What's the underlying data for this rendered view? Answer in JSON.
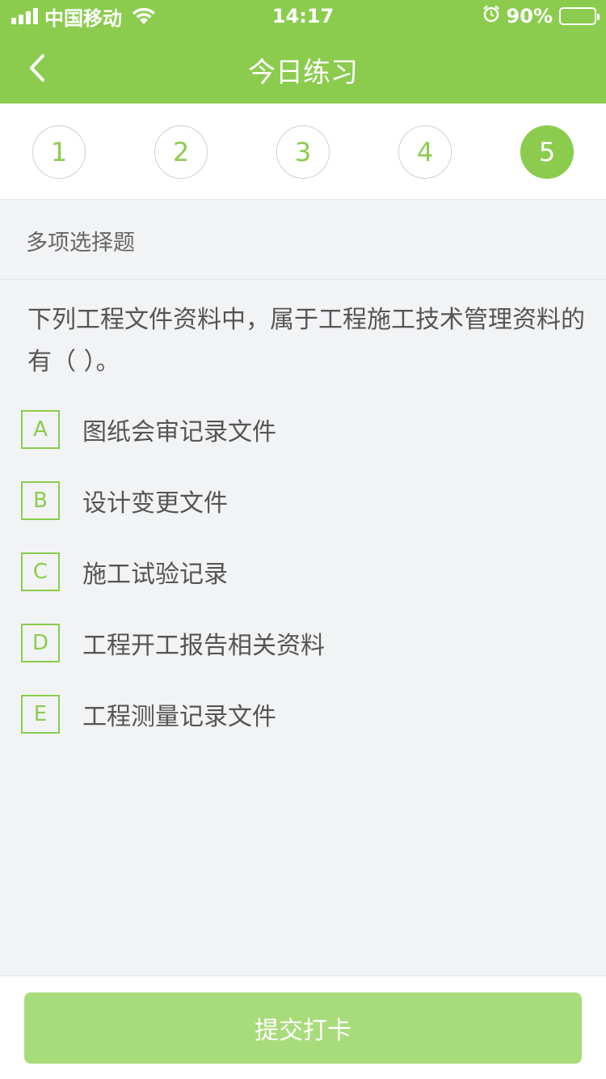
{
  "status_bar": {
    "carrier": "中国移动",
    "time": "14:17",
    "battery": "90%",
    "battery_level": 0.9
  },
  "nav": {
    "title": "今日练习",
    "back_icon": "chevron-left-icon"
  },
  "question_numbers": [
    {
      "label": "1",
      "active": false
    },
    {
      "label": "2",
      "active": false
    },
    {
      "label": "3",
      "active": false
    },
    {
      "label": "4",
      "active": false
    },
    {
      "label": "5",
      "active": true
    }
  ],
  "question": {
    "type": "多项选择题",
    "text": "下列工程文件资料中，属于工程施工技术管理资料的有（    ）。",
    "options": [
      {
        "letter": "A",
        "text": "图纸会审记录文件"
      },
      {
        "letter": "B",
        "text": "设计变更文件"
      },
      {
        "letter": "C",
        "text": "施工试验记录"
      },
      {
        "letter": "D",
        "text": "工程开工报告相关资料"
      },
      {
        "letter": "E",
        "text": "工程测量记录文件"
      }
    ]
  },
  "footer": {
    "submit_label": "提交打卡"
  },
  "colors": {
    "primary": "#8bcc4e",
    "button_disabled": "#a8dc7a"
  }
}
